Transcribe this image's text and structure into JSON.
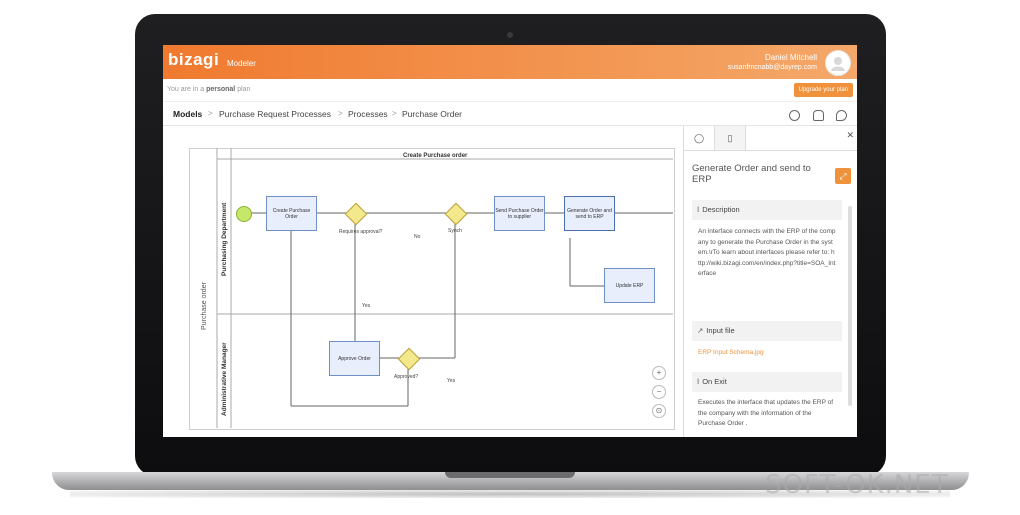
{
  "app": {
    "logo": "bizagi",
    "product": "Modeler"
  },
  "user": {
    "name": "Daniel Mitchell",
    "email": "susanfmcnabb@dayrep.com"
  },
  "plan": {
    "prefix": "You are in a ",
    "type": "personal",
    "suffix": " plan",
    "upgrade_label": "Upgrade your plan"
  },
  "breadcrumb": {
    "items": [
      "Models",
      "Purchase Request Processes",
      "Processes",
      "Purchase Order"
    ],
    "separator": ">"
  },
  "diagram": {
    "pool": "Purchase order",
    "title": "Create Purchase order",
    "lanes": [
      "Purchasing Department",
      "Administrative Manager"
    ],
    "tasks": {
      "create": "Create Purchase Order",
      "send": "Send Purchase Order to supplier",
      "generate": "Generate Order and send to ERP",
      "update": "Update ERP",
      "approve": "Approve Order"
    },
    "labels": {
      "requires": "Requires approval?",
      "no": "No",
      "synch": "Synch",
      "yes1": "Yes",
      "approved": "Approved?",
      "yes2": "Yes"
    }
  },
  "panel": {
    "title": "Generate Order and send to ERP",
    "description_head": "Description",
    "description": "An interface connects with the ERP of the company to generate the Purchase Order in the system.\\rTo learn about interfaces please refer to: http://wiki.bizagi.com/en/index.php?title=SOA_Interface",
    "input_head": "Input file",
    "input_link": "ERP Input Schema.jpg",
    "onexit_head": "On Exit",
    "onexit": "Executes the interface that updates the ERP of the company with the information of the Purchase Order ."
  },
  "watermark": "SOFT-OK.NET",
  "colors": {
    "accent": "#f0923c",
    "header_start": "#f07a2f",
    "header_end": "#f4a869"
  }
}
